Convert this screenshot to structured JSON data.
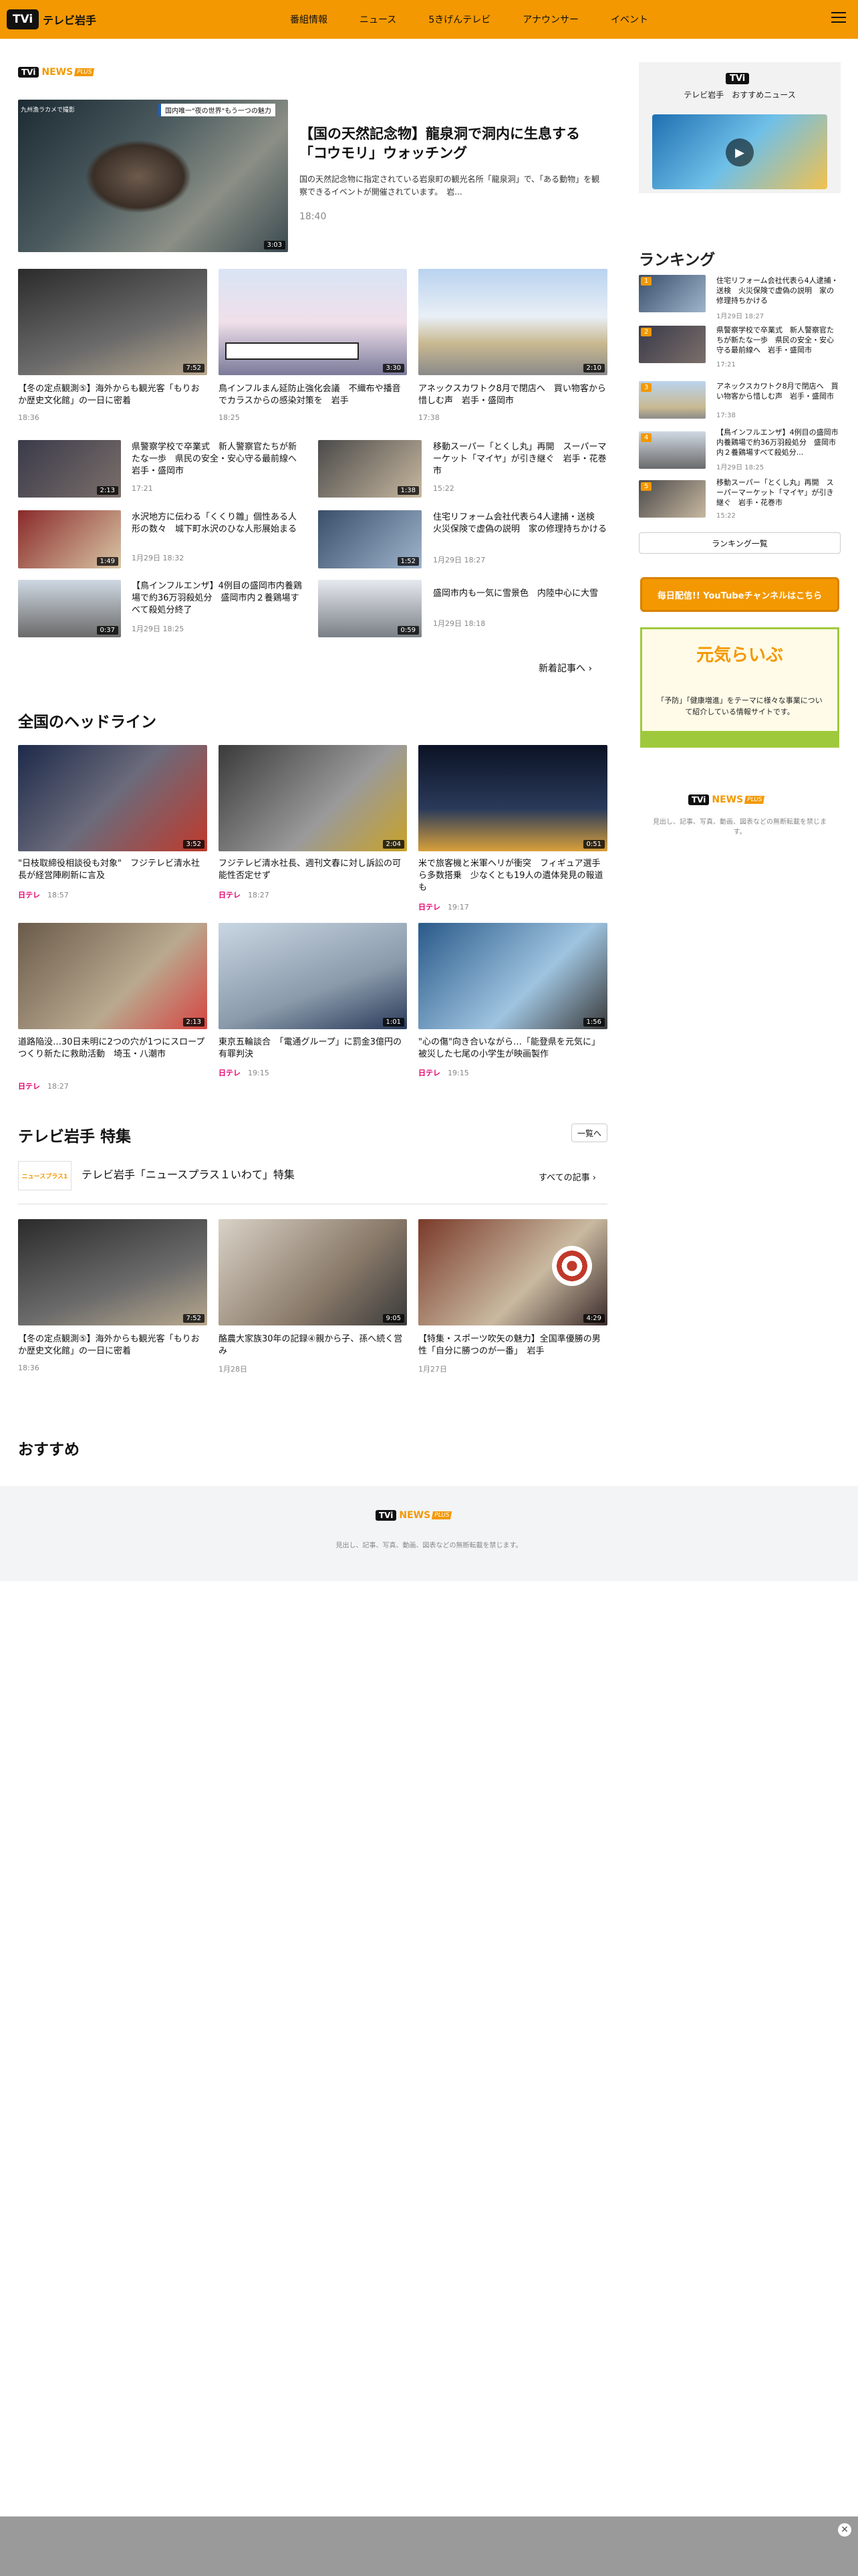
{
  "header": {
    "logo": "TVi",
    "logo_text": "テレビ岩手",
    "nav": [
      "番組情報",
      "ニュース",
      "5きげんテレビ",
      "アナウンサー",
      "イベント"
    ]
  },
  "brand": {
    "tvi": "TVi",
    "news": "NEWS",
    "plus": "PLUS"
  },
  "hero": {
    "title": "【国の天然記念物】龍泉洞で洞内に生息する「コウモリ」ウォッチング",
    "lead": "国の天然記念物に指定されている岩泉町の観光名所「龍泉洞」で、「ある動物」を観察できるイベントが開催されています。　岩...",
    "time": "18:40",
    "duration": "3:03",
    "caption": "国内唯一\"夜の世界\"もう一つの魅力",
    "caption_small": "九州漁ラカメで撮影"
  },
  "top_grid": [
    {
      "title": "【冬の定点観測⑤】海外からも観光客「もりおか歴史文化館」の一日に密着",
      "time": "18:36",
      "duration": "7:52"
    },
    {
      "title": "鳥インフルまん延防止強化会議　不織布や播音でカラスからの感染対策を　岩手",
      "time": "18:25",
      "duration": "3:30"
    },
    {
      "title": "アネックスカワトク8月で閉店へ　買い物客から惜しむ声　岩手・盛岡市",
      "time": "17:38",
      "duration": "2:10"
    }
  ],
  "list_items": [
    {
      "title": "県警察学校で卒業式　新人警察官たちが新たな一歩　県民の安全・安心守る最前線へ　岩手・盛岡市",
      "time": "17:21",
      "duration": "2:13"
    },
    {
      "title": "移動スーパー「とくし丸」再開　スーパーマーケット「マイヤ」が引き継ぐ　岩手・花巻市",
      "time": "15:22",
      "duration": "1:38"
    },
    {
      "title": "水沢地方に伝わる「くくり雛」個性ある人形の数々　城下町水沢のひな人形展始まる",
      "time": "1月29日 18:32",
      "duration": "1:49"
    },
    {
      "title": "住宅リフォーム会社代表ら4人逮捕・送検　火災保険で虚偽の説明　家の修理持ちかける",
      "time": "1月29日 18:27",
      "duration": "1:52"
    },
    {
      "title": "【鳥インフルエンザ】4例目の盛岡市内養鶏場で約36万羽殺処分　盛岡市内２養鶏場すべて殺処分終了",
      "time": "1月29日 18:25",
      "duration": "0:37"
    },
    {
      "title": "盛岡市内も一気に雪景色　内陸中心に大雪",
      "time": "1月29日 18:18",
      "duration": "0:59"
    }
  ],
  "more_news": "新着記事へ",
  "national": {
    "title": "全国のヘッドライン",
    "items": [
      {
        "title": "\"日枝取締役相談役も対象\"　フジテレビ清水社長が経営陣刷新に言及",
        "source": "日テレ",
        "time": "18:57",
        "duration": "3:52"
      },
      {
        "title": "フジテレビ清水社長、週刊文春に対し訴訟の可能性否定せず",
        "source": "日テレ",
        "time": "18:27",
        "duration": "2:04"
      },
      {
        "title": "米で旅客機と米軍ヘリが衝突　フィギュア選手ら多数搭乗　少なくとも19人の遺体発見の報道も",
        "source": "日テレ",
        "time": "19:17",
        "duration": "0:51"
      },
      {
        "title": "道路陥没…30日未明に2つの穴が1つにスロープつくり新たに救助活動　埼玉・八潮市",
        "source": "日テレ",
        "time": "18:27",
        "duration": "2:13"
      },
      {
        "title": "東京五輪談合　「電通グループ」に罰金3億円の有罪判決",
        "source": "日テレ",
        "time": "19:15",
        "duration": "1:01"
      },
      {
        "title": "\"心の傷\"向き合いながら…「能登県を元気に」被災した七尾の小学生が映画製作",
        "source": "日テレ",
        "time": "19:15",
        "duration": "1:56"
      }
    ]
  },
  "feature": {
    "title": "テレビ岩手 特集",
    "list_btn": "一覧へ",
    "program_logo": "ニュースプラス1",
    "program_title": "テレビ岩手「ニュースプラス１いわて」特集",
    "all_link": "すべての記事",
    "items": [
      {
        "title": "【冬の定点観測⑤】海外からも観光客「もりおか歴史文化館」の一日に密着",
        "time": "18:36",
        "duration": "7:52"
      },
      {
        "title": "酪農大家族30年の記録④親から子、孫へ続く営み",
        "time": "1月28日",
        "duration": "9:05"
      },
      {
        "title": "【特集・スポーツ吹矢の魅力】全国準優勝の男性「自分に勝つのが一番」　岩手",
        "time": "1月27日",
        "duration": "4:29"
      }
    ]
  },
  "recommend": {
    "title": "おすすめ"
  },
  "sidebar": {
    "promo_logo": "TVi",
    "promo_title": "テレビ岩手　おすすめニュース",
    "ranking_title": "ランキング",
    "ranking": [
      {
        "rank": "1",
        "title": "住宅リフォーム会社代表ら4人逮捕・送検　火災保険で虚偽の説明　家の修理持ちかける",
        "time": "1月29日 18:27"
      },
      {
        "rank": "2",
        "title": "県警察学校で卒業式　新人警察官たちが新たな一歩　県民の安全・安心守る最前線へ　岩手・盛岡市",
        "time": "17:21"
      },
      {
        "rank": "3",
        "title": "アネックスカワトク8月で閉店へ　買い物客から惜しむ声　岩手・盛岡市",
        "time": "17:38"
      },
      {
        "rank": "4",
        "title": "【鳥インフルエンザ】4例目の盛岡市内養鶏場で約36万羽殺処分　盛岡市内２養鶏場すべて殺処分...",
        "time": "1月29日 18:25"
      },
      {
        "rank": "5",
        "title": "移動スーパー「とくし丸」再開　スーパーマーケット「マイヤ」が引き継ぐ　岩手・花巻市",
        "time": "15:22"
      }
    ],
    "ranking_list_btn": "ランキング一覧",
    "youtube_banner": "毎日配信!! YouTubeチャンネルはこちら",
    "genki_title": "元気らいぶ",
    "genki_text": "「予防」「健康増進」をテーマに様々な事業について紹介している情報サイトです。",
    "copyright": "見出し、記事、写真、動画、図表などの無断転載を禁じます。"
  },
  "footer": {
    "copyright": "見出し、記事、写真、動画、図表などの無断転載を禁じます。"
  },
  "colors": {
    "accent": "#f39800",
    "ntv": "#e4006e"
  }
}
